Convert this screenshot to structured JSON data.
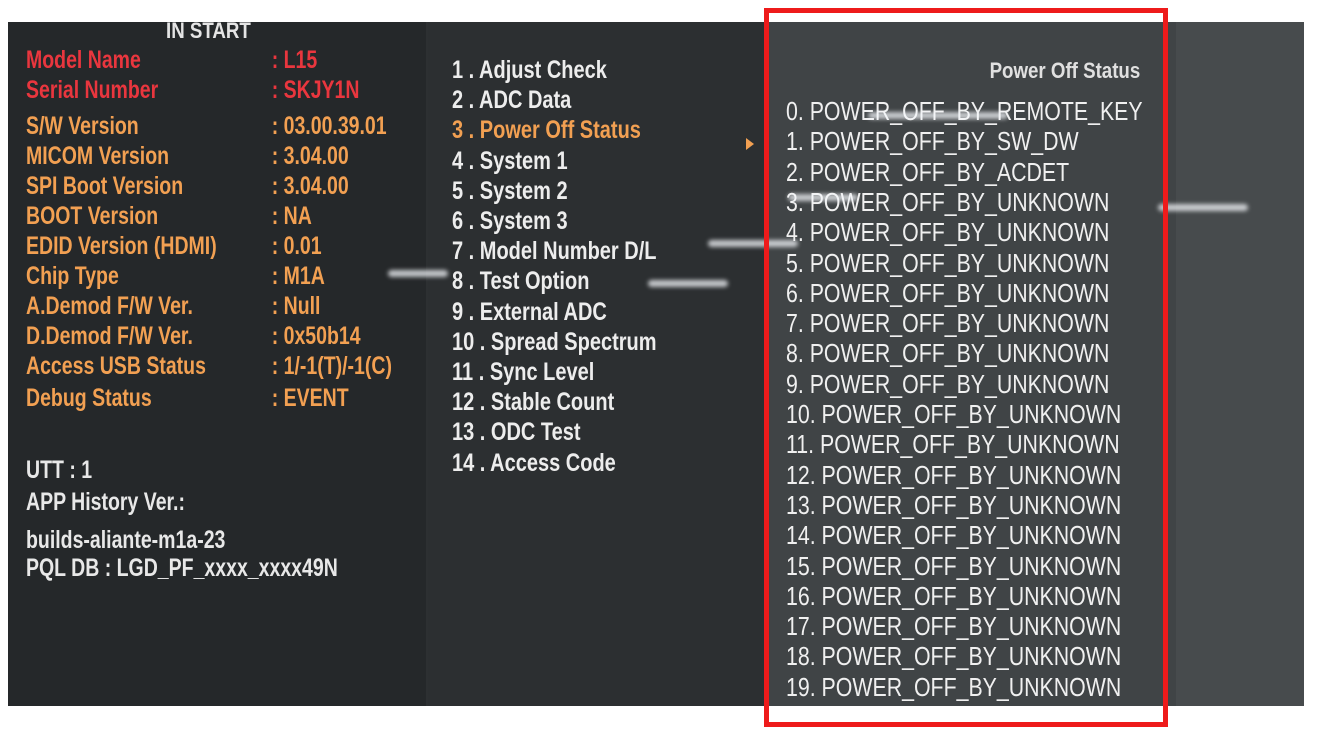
{
  "info_panel": {
    "header": "IN START",
    "rows": [
      {
        "label": "Model Name",
        "value": ": L15"
      },
      {
        "label": "Serial Number",
        "value": ": SKJY1N"
      },
      {
        "label": "S/W Version",
        "value": ": 03.00.39.01"
      },
      {
        "label": "MICOM Version",
        "value": ": 3.04.00"
      },
      {
        "label": "SPI Boot Version",
        "value": ": 3.04.00"
      },
      {
        "label": "BOOT Version",
        "value": ": NA"
      },
      {
        "label": "EDID Version (HDMI)",
        "value": ": 0.01"
      },
      {
        "label": "Chip Type",
        "value": ": M1A"
      },
      {
        "label": "A.Demod F/W Ver.",
        "value": ": Null"
      },
      {
        "label": "D.Demod F/W Ver.",
        "value": ": 0x50b14"
      },
      {
        "label": "Access USB Status",
        "value": ": 1/-1(T)/-1(C)"
      },
      {
        "label": "Debug Status",
        "value": ": EVENT"
      }
    ],
    "utt": "UTT : 1",
    "app_history_label": "APP History Ver.:",
    "app_history_value": "builds-aliante-m1a-23",
    "pql_db": "PQL DB : LGD_PF_xxxx_xxxx49N"
  },
  "menu": {
    "items": [
      "1 . Adjust Check",
      "2 . ADC Data",
      "3 . Power Off Status",
      "4 . System 1",
      "5 . System 2",
      "6 . System 3",
      "7 . Model Number D/L",
      "8 . Test Option",
      "9 . External ADC",
      "10 . Spread Spectrum",
      "11 . Sync Level",
      "12 . Stable Count",
      "13 . ODC Test",
      "14 . Access Code"
    ],
    "selected_index": 2
  },
  "status_panel": {
    "title": "Power Off Status",
    "lines": [
      "0. POWER_OFF_BY_REMOTE_KEY",
      "1. POWER_OFF_BY_SW_DW",
      "2. POWER_OFF_BY_ACDET",
      "3. POWER_OFF_BY_UNKNOWN",
      "4. POWER_OFF_BY_UNKNOWN",
      "5. POWER_OFF_BY_UNKNOWN",
      "6. POWER_OFF_BY_UNKNOWN",
      "7. POWER_OFF_BY_UNKNOWN",
      "8. POWER_OFF_BY_UNKNOWN",
      "9. POWER_OFF_BY_UNKNOWN",
      "10. POWER_OFF_BY_UNKNOWN",
      "11. POWER_OFF_BY_UNKNOWN",
      "12. POWER_OFF_BY_UNKNOWN",
      "13. POWER_OFF_BY_UNKNOWN",
      "14. POWER_OFF_BY_UNKNOWN",
      "15. POWER_OFF_BY_UNKNOWN",
      "16. POWER_OFF_BY_UNKNOWN",
      "17. POWER_OFF_BY_UNKNOWN",
      "18. POWER_OFF_BY_UNKNOWN",
      "19. POWER_OFF_BY_UNKNOWN"
    ]
  },
  "colors": {
    "label_red": "#e9363e",
    "label_orange": "#f2a052",
    "text_white": "#eeeeee",
    "highlight": "#ee1b1b"
  }
}
